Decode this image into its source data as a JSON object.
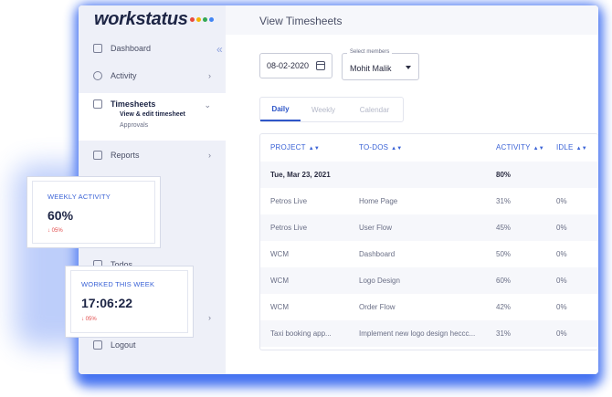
{
  "app": {
    "logo_text": "workstatus",
    "logo_dot_colors": [
      "#e94c3d",
      "#f4b400",
      "#34a853",
      "#4285f4"
    ],
    "page_title": "View Timesheets",
    "accent_color": "#2e56c8"
  },
  "sidebar": {
    "collapse_icon": "double-chevron-left-icon",
    "items": [
      {
        "label": "Dashboard",
        "icon": "dashboard-icon"
      },
      {
        "label": "Activity",
        "icon": "activity-icon"
      },
      {
        "label": "Timesheets",
        "icon": "timesheet-icon",
        "active": true,
        "subitems": [
          "View & edit timesheet",
          "Approvals"
        ]
      },
      {
        "label": "Reports",
        "icon": "reports-icon"
      },
      {
        "label": "Todos",
        "icon": "todos-icon"
      },
      {
        "label": "Logout",
        "icon": "logout-icon"
      }
    ]
  },
  "filters": {
    "date_value": "08-02-2020",
    "member_legend": "Select members",
    "member_value": "Mohit Malik"
  },
  "tabs": [
    {
      "label": "Daily",
      "active": true
    },
    {
      "label": "Weekly",
      "active": false
    },
    {
      "label": "Calendar",
      "active": false
    }
  ],
  "table": {
    "headers": [
      "PROJECT",
      "TO-DOS",
      "ACTIVITY",
      "IDLE"
    ],
    "date_row": {
      "date": "Tue, Mar 23, 2021",
      "activity": "80%"
    },
    "rows": [
      {
        "project": "Petros Live",
        "todo": "Home Page",
        "activity": "31%",
        "idle": "0%"
      },
      {
        "project": "Petros Live",
        "todo": "User Flow",
        "activity": "45%",
        "idle": "0%"
      },
      {
        "project": "WCM",
        "todo": "Dashboard",
        "activity": "50%",
        "idle": "0%"
      },
      {
        "project": "WCM",
        "todo": "Logo Design",
        "activity": "60%",
        "idle": "0%"
      },
      {
        "project": "WCM",
        "todo": "Order Flow",
        "activity": "42%",
        "idle": "0%"
      },
      {
        "project": "Taxi booking app...",
        "todo": "Implement new logo design heccc...",
        "activity": "31%",
        "idle": "0%"
      }
    ]
  },
  "cards": {
    "weekly": {
      "label": "WEEKLY ACTIVITY",
      "value": "60%",
      "delta": "↓ 05%"
    },
    "worked": {
      "label": "WORKED THIS WEEK",
      "value": "17:06:22",
      "delta": "↓ 05%"
    }
  }
}
